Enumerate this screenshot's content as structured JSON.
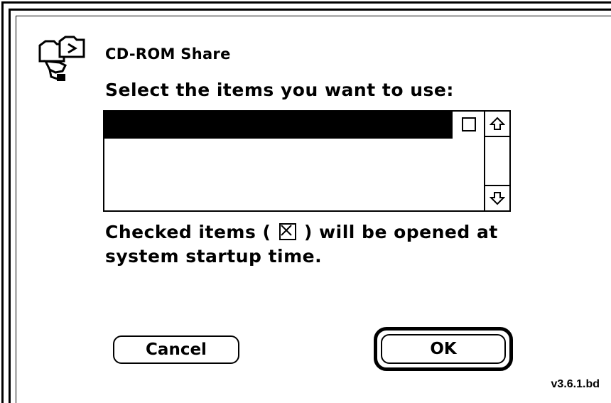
{
  "dialog": {
    "title": "CD-ROM Share",
    "prompt": "Select the items you want to use:",
    "info_before": "Checked items (",
    "info_after": ") will be opened at",
    "info_line2": "system startup time.",
    "version": "v3.6.1.bd",
    "app_icon": "cd-rom-share-icon"
  },
  "list": {
    "items": [
      {
        "label": "",
        "checked": false,
        "selected": true
      }
    ],
    "scroll_up_icon": "scroll-up-arrow-icon",
    "scroll_down_icon": "scroll-down-arrow-icon"
  },
  "buttons": {
    "cancel_label": "Cancel",
    "ok_label": "OK",
    "default": "ok"
  }
}
